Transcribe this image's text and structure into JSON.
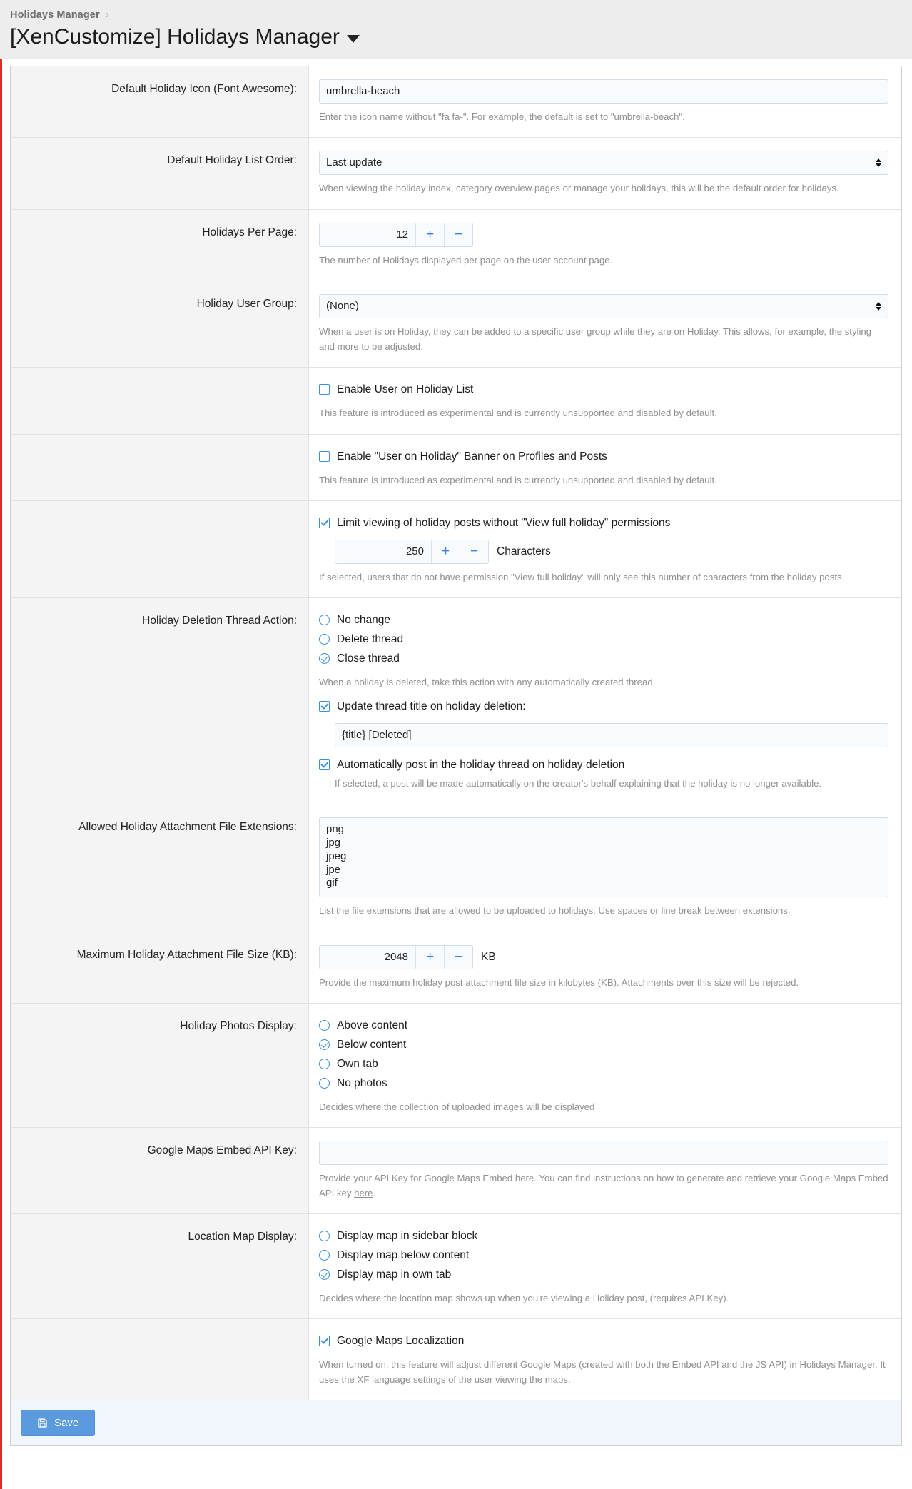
{
  "header": {
    "breadcrumb": "Holidays Manager",
    "breadcrumb_separator": "›",
    "title": "[XenCustomize] Holidays Manager",
    "caret_icon": "chevron-down-icon"
  },
  "fields": {
    "default_icon": {
      "label": "Default Holiday Icon (Font Awesome):",
      "value": "umbrella-beach",
      "explain": "Enter the icon name without \"fa fa-\". For example, the default is set to \"umbrella-beach\"."
    },
    "list_order": {
      "label": "Default Holiday List Order:",
      "value": "Last update",
      "explain": "When viewing the holiday index, category overview pages or manage your holidays, this will be the default order for holidays."
    },
    "per_page": {
      "label": "Holidays Per Page:",
      "value": "12",
      "plus": "+",
      "minus": "−",
      "explain": "The number of Holidays displayed per page on the user account page."
    },
    "user_group": {
      "label": "Holiday User Group:",
      "value": "(None)",
      "explain": "When a user is on Holiday, they can be added to a specific user group while they are on Holiday. This allows, for example, the styling and more to be adjusted."
    },
    "enable_list": {
      "label": "Enable User on Holiday List",
      "checked": false,
      "explain": "This feature is introduced as experimental and is currently unsupported and disabled by default."
    },
    "enable_banner": {
      "label": "Enable \"User on Holiday\" Banner on Profiles and Posts",
      "checked": false,
      "explain": "This feature is introduced as experimental and is currently unsupported and disabled by default."
    },
    "limit_viewing": {
      "label": "Limit viewing of holiday posts without \"View full holiday\" permissions",
      "checked": true,
      "value": "250",
      "plus": "+",
      "minus": "−",
      "unit": "Characters",
      "explain": "If selected, users that do not have permission \"View full holiday\" will only see this number of characters from the holiday posts."
    },
    "deletion_action": {
      "label": "Holiday Deletion Thread Action:",
      "options": [
        {
          "label": "No change",
          "selected": false
        },
        {
          "label": "Delete thread",
          "selected": false
        },
        {
          "label": "Close thread",
          "selected": true
        }
      ],
      "explain": "When a holiday is deleted, take this action with any automatically created thread.",
      "update_title": {
        "label": "Update thread title on holiday deletion:",
        "checked": true,
        "value": "{title} [Deleted]"
      },
      "auto_post": {
        "label": "Automatically post in the holiday thread on holiday deletion",
        "checked": true,
        "explain": "If selected, a post will be made automatically on the creator's behalf explaining that the holiday is no longer available."
      }
    },
    "extensions": {
      "label": "Allowed Holiday Attachment File Extensions:",
      "value": "png\njpg\njpeg\njpe\ngif",
      "explain": "List the file extensions that are allowed to be uploaded to holidays. Use spaces or line break between extensions."
    },
    "max_size": {
      "label": "Maximum Holiday Attachment File Size (KB):",
      "value": "2048",
      "plus": "+",
      "minus": "−",
      "unit": "KB",
      "explain": "Provide the maximum holiday post attachment file size in kilobytes (KB). Attachments over this size will be rejected."
    },
    "photos_display": {
      "label": "Holiday Photos Display:",
      "options": [
        {
          "label": "Above content",
          "selected": false
        },
        {
          "label": "Below content",
          "selected": true
        },
        {
          "label": "Own tab",
          "selected": false
        },
        {
          "label": "No photos",
          "selected": false
        }
      ],
      "explain": "Decides where the collection of uploaded images will be displayed"
    },
    "api_key": {
      "label": "Google Maps Embed API Key:",
      "value": "",
      "explain_before": "Provide your API Key for Google Maps Embed here. You can find instructions on how to generate and retrieve your Google Maps Embed API key ",
      "explain_link": "here",
      "explain_after": "."
    },
    "map_display": {
      "label": "Location Map Display:",
      "options": [
        {
          "label": "Display map in sidebar block",
          "selected": false
        },
        {
          "label": "Display map below content",
          "selected": false
        },
        {
          "label": "Display map in own tab",
          "selected": true
        }
      ],
      "explain": "Decides where the location map shows up when you're viewing a Holiday post, (requires API Key)."
    },
    "localization": {
      "label": "Google Maps Localization",
      "checked": true,
      "explain": "When turned on, this feature will adjust different Google Maps (created with both the Embed API and the JS API) in Holidays Manager. It uses the XF language settings of the user viewing the maps."
    }
  },
  "footer": {
    "save_label": "Save",
    "save_icon": "save-icon"
  }
}
